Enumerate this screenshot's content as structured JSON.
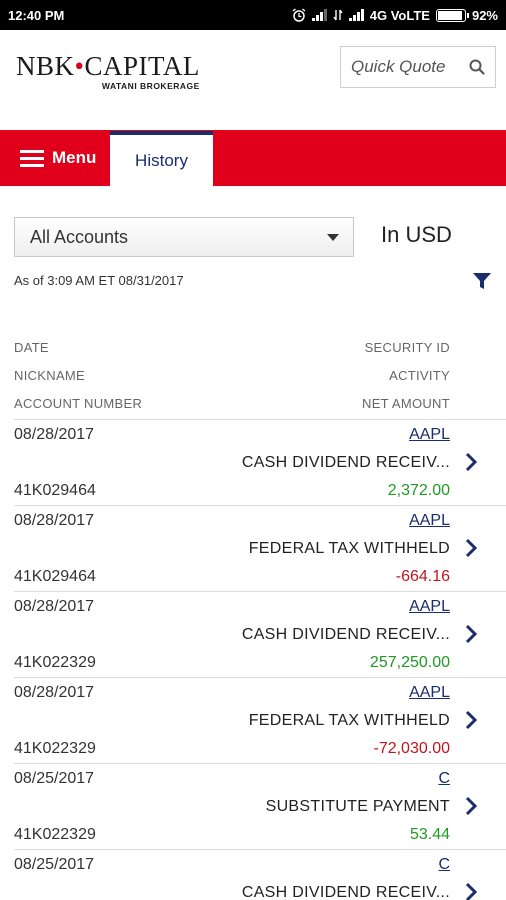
{
  "status_bar": {
    "time": "12:40 PM",
    "network": "4G VoLTE",
    "battery": "92%",
    "battery_level": 0.92,
    "icons": [
      "alarm-icon",
      "signal-icon",
      "data-icon",
      "signal-icon",
      "battery-icon"
    ]
  },
  "header": {
    "logo_main_left": "NBK",
    "logo_main_right": "CAPITAL",
    "logo_sub": "WATANI BROKERAGE",
    "quick_quote_placeholder": "Quick Quote",
    "search_icon": "search-icon"
  },
  "nav": {
    "menu_label": "Menu",
    "history_label": "History"
  },
  "controls": {
    "account_selected": "All Accounts",
    "currency_label": "In USD",
    "as_of": "As of 3:09 AM ET 08/31/2017",
    "filter_icon": "filter-icon"
  },
  "columns": {
    "row1": {
      "left": "DATE",
      "right": "SECURITY ID"
    },
    "row2": {
      "left": "NICKNAME",
      "right": "ACTIVITY"
    },
    "row3": {
      "left": "ACCOUNT NUMBER",
      "right": "NET AMOUNT"
    }
  },
  "colors": {
    "brand_red": "#e0001b",
    "brand_navy": "#1a2d6d",
    "positive": "#1f9a22",
    "negative": "#c0151c"
  },
  "transactions": [
    {
      "date": "08/28/2017",
      "security": "AAPL",
      "activity": "CASH DIVIDEND RECEIV...",
      "account": "41K029464",
      "amount": "2,372.00",
      "sign": "positive"
    },
    {
      "date": "08/28/2017",
      "security": "AAPL",
      "activity": "FEDERAL TAX WITHHELD",
      "account": "41K029464",
      "amount": "-664.16",
      "sign": "negative"
    },
    {
      "date": "08/28/2017",
      "security": "AAPL",
      "activity": "CASH DIVIDEND RECEIV...",
      "account": "41K022329",
      "amount": "257,250.00",
      "sign": "positive"
    },
    {
      "date": "08/28/2017",
      "security": "AAPL",
      "activity": "FEDERAL TAX WITHHELD",
      "account": "41K022329",
      "amount": "-72,030.00",
      "sign": "negative"
    },
    {
      "date": "08/25/2017",
      "security": "C",
      "activity": "SUBSTITUTE PAYMENT",
      "account": "41K022329",
      "amount": "53.44",
      "sign": "positive"
    },
    {
      "date": "08/25/2017",
      "security": "C",
      "activity": "CASH DIVIDEND RECEIV...",
      "account": "",
      "amount": "",
      "sign": "positive"
    }
  ]
}
